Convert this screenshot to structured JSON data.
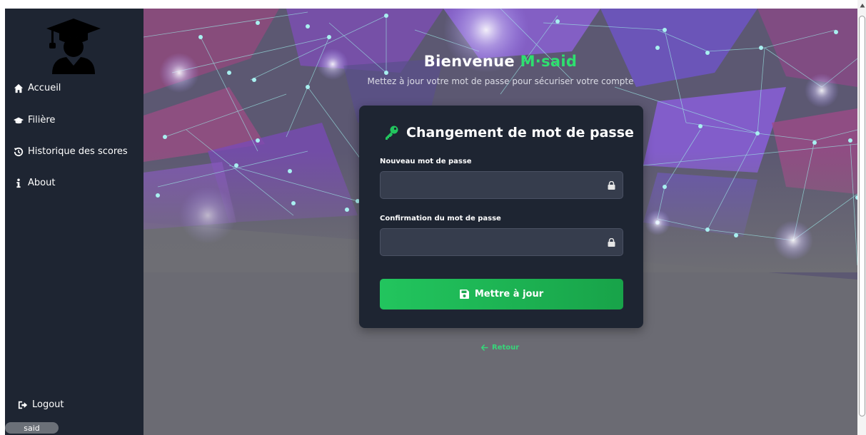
{
  "sidebar": {
    "items": [
      {
        "label": "Accueil",
        "icon": "home-icon"
      },
      {
        "label": "Filière",
        "icon": "graduation-cap-icon"
      },
      {
        "label": "Historique des scores",
        "icon": "history-icon"
      },
      {
        "label": "About",
        "icon": "info-icon"
      }
    ],
    "logout_label": "Logout",
    "username_badge": "said"
  },
  "header": {
    "welcome_prefix": "Bienvenue",
    "welcome_name": "M·said",
    "subtitle": "Mettez à jour votre mot de passe pour sécuriser votre compte"
  },
  "form": {
    "title": "Changement de mot de passe",
    "new_password_label": "Nouveau mot de passe",
    "new_password_value": "",
    "confirm_password_label": "Confirmation du mot de passe",
    "confirm_password_value": "",
    "submit_label": "Mettre à jour",
    "back_label": "Retour"
  },
  "colors": {
    "sidebar_bg": "#1e2532",
    "card_bg": "#1e2532",
    "accent_green": "#22c55e",
    "field_bg": "#363d4d"
  }
}
